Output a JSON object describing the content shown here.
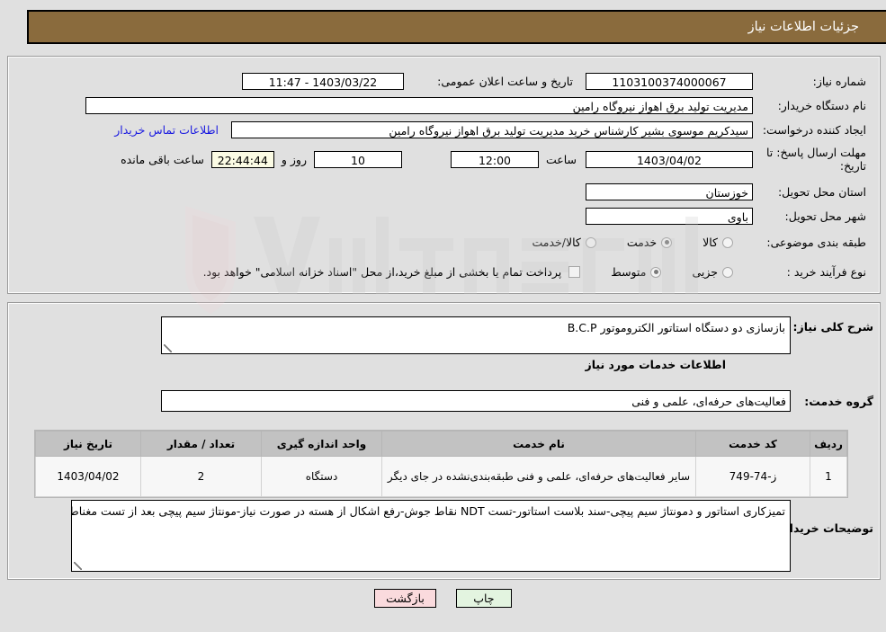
{
  "header": {
    "title": "جزئیات اطلاعات نیاز",
    "bar_color": "#8a6b3d"
  },
  "form": {
    "need_number_label": "شماره نیاز:",
    "need_number_value": "1103100374000067",
    "announce_datetime_label": "تاریخ و ساعت اعلان عمومی:",
    "announce_datetime_value": "1403/03/22 - 11:47",
    "buyer_org_label": "نام دستگاه خریدار:",
    "buyer_org_value": "مدیریت تولید برق اهواز نیروگاه رامین",
    "creator_label": "ایجاد کننده درخواست:",
    "creator_value": "سیدکریم موسوی بشیر کارشناس خرید مدیریت تولید برق اهواز نیروگاه رامین",
    "contact_link": "اطلاعات تماس خریدار",
    "deadline_label": "مهلت ارسال پاسخ: تا تاریخ:",
    "deadline_date": "1403/04/02",
    "time_label": "ساعت",
    "time_value": "12:00",
    "days_value": "10",
    "days_and_label": "روز و",
    "countdown_value": "22:44:44",
    "remaining_label": "ساعت باقی مانده",
    "province_label": "استان محل تحویل:",
    "province_value": "خوزستان",
    "city_label": "شهر محل تحویل:",
    "city_value": "باوی",
    "category_label": "طبقه بندی موضوعی:",
    "category_options": [
      {
        "label": "کالا",
        "checked": false
      },
      {
        "label": "خدمت",
        "checked": true
      },
      {
        "label": "کالا/خدمت",
        "checked": false
      }
    ],
    "process_label": "نوع فرآیند خرید :",
    "process_options": [
      {
        "label": "جزیی",
        "checked": false
      },
      {
        "label": "متوسط",
        "checked": true
      }
    ],
    "treasury_checkbox_checked": false,
    "treasury_note": "پرداخت تمام یا بخشی از مبلغ خرید،از محل \"اسناد خزانه اسلامی\" خواهد بود."
  },
  "summary": {
    "label": "شرح کلی نیاز:",
    "value": "بازسازی دو دستگاه استاتور الکتروموتور B.C.P"
  },
  "services_section": {
    "title": "اطلاعات خدمات مورد نیاز",
    "group_label": "گروه خدمت:",
    "group_value": "فعالیت‌های حرفه‌ای، علمی و فنی"
  },
  "table": {
    "columns": [
      "ردیف",
      "کد خدمت",
      "نام خدمت",
      "واحد اندازه گیری",
      "تعداد / مقدار",
      "تاریخ نیاز"
    ],
    "rows": [
      {
        "row": "1",
        "code": "ز-74-749",
        "name": "سایر فعالیت‌های حرفه‌ای، علمی و فنی طبقه‌بندی‌نشده در جای دیگر",
        "unit": "دستگاه",
        "qty": "2",
        "date": "1403/04/02"
      }
    ]
  },
  "buyer_notes": {
    "label": "توضیحات خریدار:",
    "value": "تمیزکاری استاتور و دمونتاژ سیم پیچی-سند بلاست استاتور-تست NDT  نقاط جوش-رفع اشکال از هسته در صورت نیاز-مونتاژ سیم پیچی بعد از تست مغناطیسی هسته-تست مقاومت عایقی بعد از جوشکاری لیدها و نقطه صفر طبق استاندارد IEC"
  },
  "buttons": {
    "print": "چاپ",
    "back": "بازگشت"
  },
  "watermark": {
    "text": "anaTender.net"
  }
}
